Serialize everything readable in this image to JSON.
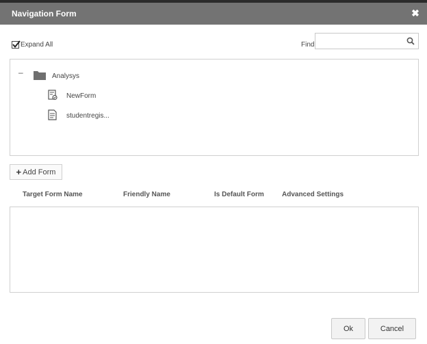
{
  "dialog": {
    "title": "Navigation Form",
    "close_icon": "close-icon"
  },
  "toolbar": {
    "expand_all_label": "Expand All",
    "expand_all_checked": true,
    "find_label": "Find",
    "find_value": "",
    "find_placeholder": "",
    "search_icon": "search-icon"
  },
  "tree": {
    "toggle_label": "–",
    "folder": {
      "label": "Analysys",
      "icon": "folder-icon"
    },
    "forms": [
      {
        "label": "NewForm",
        "icon": "form-checklist-icon"
      },
      {
        "label": "studentregis...",
        "icon": "document-icon"
      }
    ]
  },
  "add_form": {
    "label": "Add Form",
    "icon": "plus-icon"
  },
  "grid": {
    "columns": [
      "Target Form Name",
      "Friendly Name",
      "Is Default Form",
      "Advanced Settings"
    ],
    "rows": []
  },
  "footer": {
    "ok_label": "Ok",
    "cancel_label": "Cancel"
  },
  "colors": {
    "titlebar_bg": "#737373",
    "titlebar_text": "#ffffff",
    "border": "#cfcfcf",
    "icon": "#666666"
  }
}
